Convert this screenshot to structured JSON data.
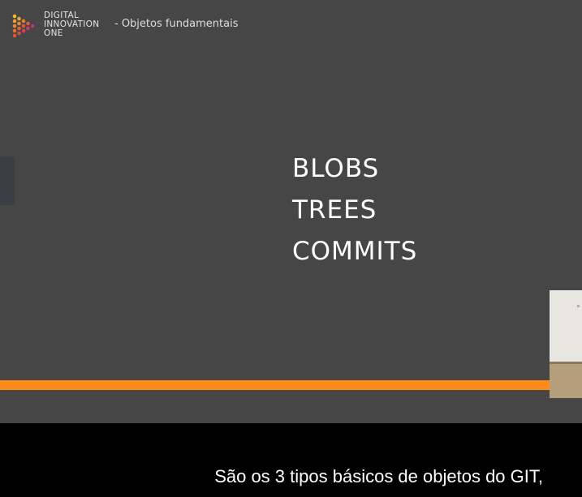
{
  "header": {
    "brand_lines": [
      "DIGITAL",
      "INNOVATION",
      "ONE"
    ],
    "lesson_title": "- Objetos fundamentais"
  },
  "slide": {
    "items": [
      "BLOBS",
      "TREES",
      "COMMITS"
    ]
  },
  "caption": {
    "text": "São os 3 tipos básicos de objetos do GIT,"
  },
  "colors": {
    "slide_background": "#464646",
    "accent_bar": "#ff8a1c",
    "caption_background": "#000000",
    "logo_gradient": [
      "#f2b233",
      "#e2542f",
      "#c1307a"
    ]
  },
  "icons": {
    "logo": "dio-hexagon-logo-icon"
  }
}
